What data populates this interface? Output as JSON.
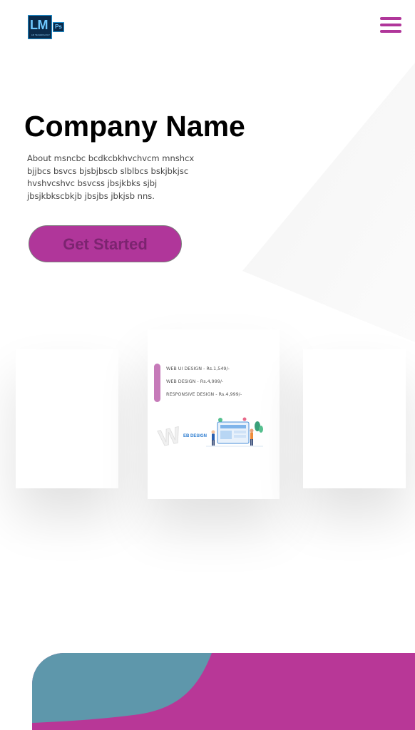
{
  "header": {
    "logo": {
      "letters": "LM",
      "badge": "Ps",
      "tagline": "LM TECHNOLOGY"
    },
    "menu_icon": "hamburger-menu-icon"
  },
  "hero": {
    "company_name": "Company Name",
    "about": "About msncbc bcdkcbkhvchvcm mnshcx bjjbcs bsvcs bjsbjbscb slblbcs bskjbkjsc hvshvcshvc bsvcss jbsjkbks sjbj jbsjkbkscbkjb jbsjbs jbkjsb nns.",
    "cta_label": "Get Started"
  },
  "pricing": {
    "cards": [
      {
        "position": "left",
        "items": []
      },
      {
        "position": "center",
        "items": [
          "WEB UI DESIGN - Rs.1,549/-",
          "WEB DESIGN - Rs.4,999/-",
          "RESPONSIVE DESIGN - Rs.4,999/-"
        ],
        "illustration_label": "EB DESIGN"
      },
      {
        "position": "right",
        "items": []
      }
    ]
  },
  "colors": {
    "accent": "#b0369a",
    "banner_magenta": "#b83797",
    "banner_teal": "#5e97ab",
    "logo_bg": "#0a2a4a",
    "logo_text": "#6fc8ff"
  }
}
